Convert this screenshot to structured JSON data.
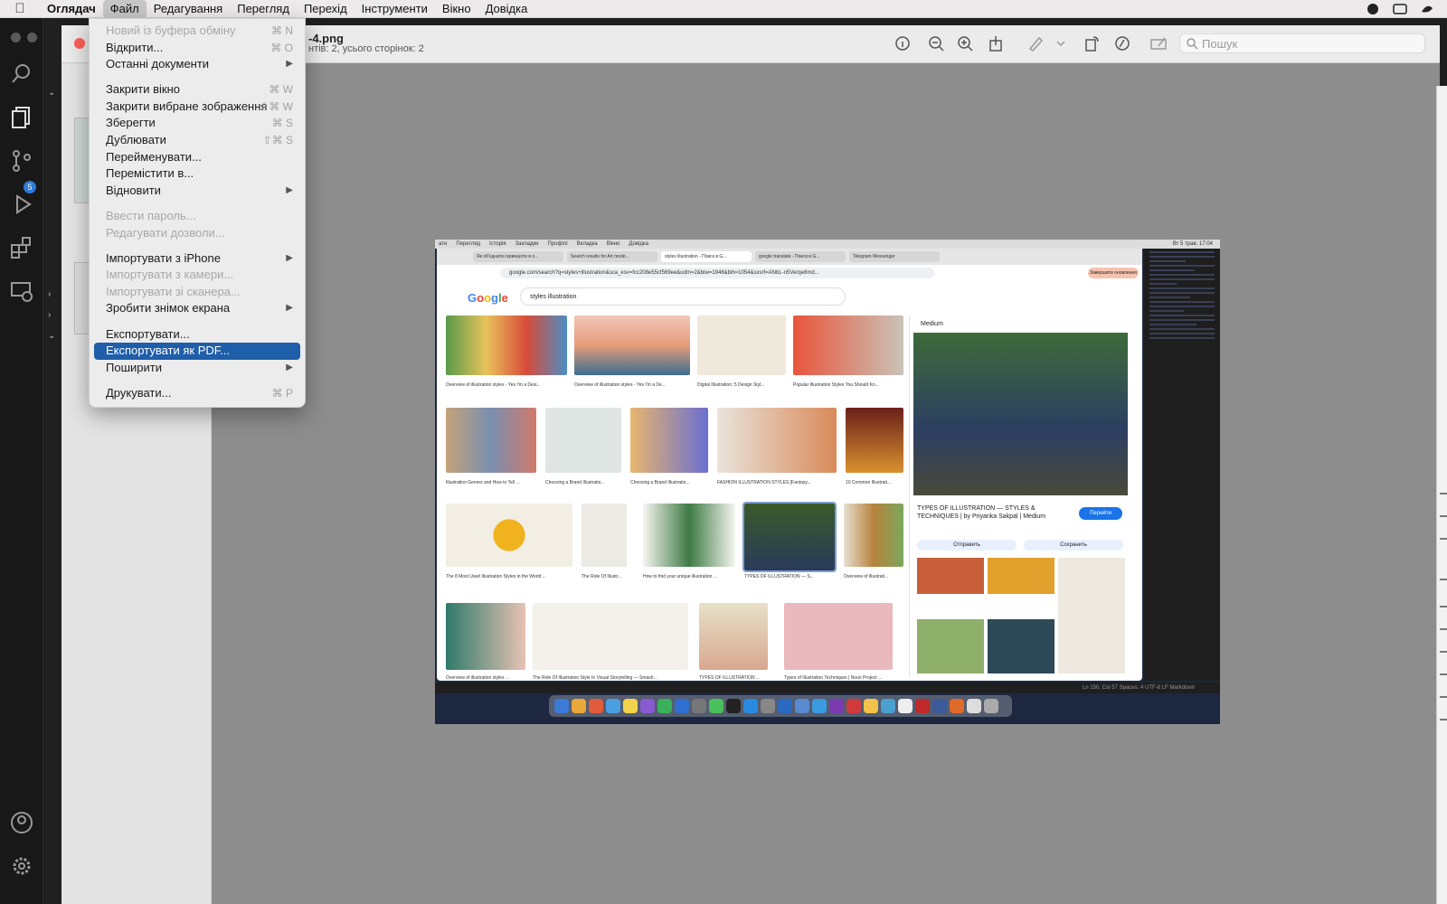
{
  "menubar": {
    "app": "Оглядач",
    "items": [
      "Файл",
      "Редагування",
      "Перегляд",
      "Перехід",
      "Інструменти",
      "Вікно",
      "Довідка"
    ]
  },
  "file_menu": {
    "items": [
      {
        "label": "Новий із буфера обміну",
        "shortcut": "⌘ N",
        "disabled": true
      },
      {
        "label": "Відкрити...",
        "shortcut": "⌘ O"
      },
      {
        "label": "Останні документи",
        "submenu": true
      },
      {
        "sep": true
      },
      {
        "label": "Закрити вікно",
        "shortcut": "⌘ W"
      },
      {
        "label": "Закрити вибране зображення",
        "shortcut": "⇧⌘ W"
      },
      {
        "label": "Зберегти",
        "shortcut": "⌘ S"
      },
      {
        "label": "Дублювати",
        "shortcut": "⇧⌘ S"
      },
      {
        "label": "Перейменувати..."
      },
      {
        "label": "Перемістити в..."
      },
      {
        "label": "Відновити",
        "submenu": true
      },
      {
        "sep": true
      },
      {
        "label": "Ввести пароль...",
        "disabled": true
      },
      {
        "label": "Редагувати дозволи...",
        "disabled": true
      },
      {
        "sep": true
      },
      {
        "label": "Імпортувати з iPhone",
        "submenu": true
      },
      {
        "label": "Імпортувати з камери...",
        "disabled": true
      },
      {
        "label": "Імпортувати зі сканера...",
        "disabled": true
      },
      {
        "label": "Зробити знімок екрана",
        "submenu": true
      },
      {
        "sep": true
      },
      {
        "label": "Експортувати..."
      },
      {
        "label": "Експортувати як PDF...",
        "selected": true
      },
      {
        "label": "Поширити",
        "submenu": true
      },
      {
        "sep": true
      },
      {
        "label": "Друкувати...",
        "shortcut": "⌘ P"
      }
    ]
  },
  "preview": {
    "title": "-4.png",
    "subtitle": "нтів: 2, усього сторінок: 2",
    "search_placeholder": "Пошук"
  },
  "activity": {
    "badge": "5"
  },
  "screenshot": {
    "menu": [
      "ати",
      "Перегляд",
      "Історія",
      "Закладки",
      "Профілі",
      "Вкладка",
      "Вікно",
      "Довідка"
    ],
    "clock": "Вт 5 трав. 17:04",
    "tabs": [
      "Як об'єднати скриншоти в о...",
      "Search results for Art mode...",
      "styles illustration - Поиск в G...",
      "google translate - Поиск в G...",
      "Telegram Messenger"
    ],
    "url": "google.com/search?q=styles+illustration&sca_esv=fcc208e55cf569ee&udm=2&biw=1946&bih=1054&sxsrf=ANbL-n5Verqe8md...",
    "update_button": "Завершити оновлення",
    "query": "styles illustration",
    "captions": [
      "Overview of illustration styles - Yes I'm a Desi...",
      "Overview of illustration styles - Yes I'm a De...",
      "Digital Illustration: 5 Design Styl...",
      "Popular Illustration Styles You Should Kn...",
      "Illustration Genres and How to Tell ...",
      "Choosing a Brand Illustratio...",
      "Choosing a Brand Illustratio...",
      "FASHION ILLUSTRATION STYLES [Fantasy...",
      "10 Common Illustrati...",
      "The 8 Most Used Illustration Styles in the World ...",
      "The Role Of Illustr...",
      "How to find your unique illustration ...",
      "TYPES OF ILLUSTRATION — S...",
      "Overview of Illustrati...",
      "Overview of illustration styles ...",
      "The Role Of Illustration Style In Visual Storytelling — Smash...",
      "TYPES OF ILLUSTRATION ...",
      "Types of Illustration Techniques | Noun Project ..."
    ],
    "panel": {
      "source": "Medium",
      "title": "TYPES OF ILLUSTRATION — STYLES & TECHNIQUES | by Priyanka Sakpal | Medium",
      "go": "Перейти",
      "send": "Отправить",
      "save": "Сохранить"
    },
    "status": "Ln 150, Col 57   Spaces: 4   UTF-8   LF   Markdown"
  },
  "colors": {
    "accent": "#1f5ea9",
    "badge": "#2f7bd6",
    "close": "#fe5f57"
  }
}
